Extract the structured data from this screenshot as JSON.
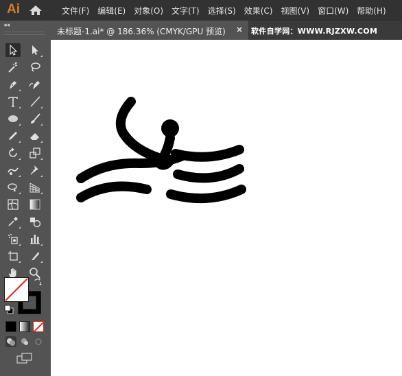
{
  "app": {
    "logo": "Ai"
  },
  "menu": [
    "文件(F)",
    "编辑(E)",
    "对象(O)",
    "文字(T)",
    "选择(S)",
    "效果(C)",
    "视图(V)",
    "窗口(W)",
    "帮助(H)"
  ],
  "document_tab": {
    "title": "未标题-1.ai* @ 186.36% (CMYK/GPU 预览)",
    "close": "×"
  },
  "watermark": "软件自学网：WWW.RJZXW.COM",
  "tools_panel": {
    "collapse": "◂◂",
    "selected_tool": "selection-tool",
    "tools": [
      "selection-tool",
      "direct-selection-tool",
      "magic-wand-tool",
      "lasso-tool",
      "pen-tool",
      "curvature-tool",
      "type-tool",
      "line-segment-tool",
      "ellipse-tool",
      "paintbrush-tool",
      "pencil-tool",
      "eraser-tool",
      "rotate-tool",
      "scale-tool",
      "warp-tool",
      "puppet-warp-tool",
      "shape-builder-tool",
      "perspective-grid-tool",
      "mesh-tool",
      "gradient-tool",
      "eyedropper-tool",
      "blend-tool",
      "symbol-sprayer-tool",
      "column-graph-tool",
      "artboard-tool",
      "slice-tool",
      "hand-tool",
      "zoom-tool"
    ]
  },
  "fill_stroke": {
    "fill": "none",
    "stroke": "#000000"
  },
  "colors": {
    "menubar": "#323232",
    "panel": "#535353",
    "canvas": "#ffffff",
    "accent": "#d17c2f",
    "art": "#000000",
    "none_slash": "#e2231a"
  }
}
